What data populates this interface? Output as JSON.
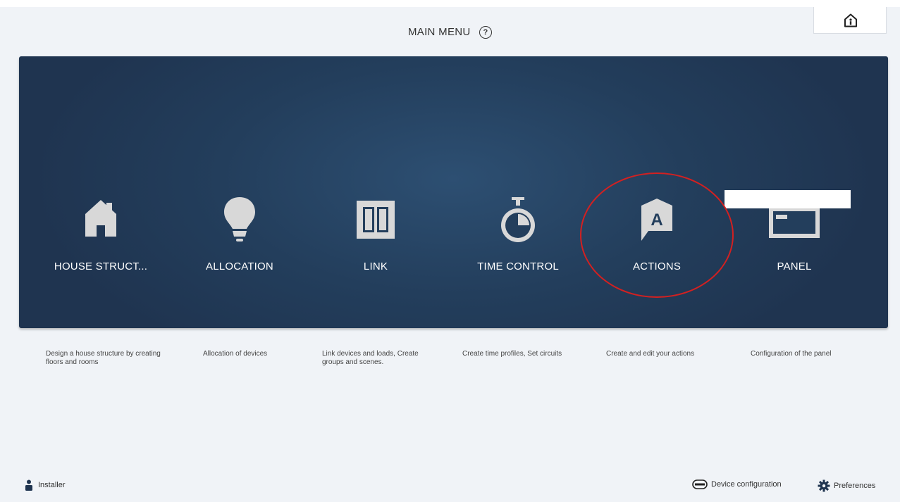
{
  "header": {
    "title": "MAIN MENU",
    "help_glyph": "?",
    "home_icon": "home-info-icon"
  },
  "menu": {
    "tiles": [
      {
        "label": "HOUSE STRUCT...",
        "icon": "house-icon",
        "description": "Design a house structure by creating floors and rooms"
      },
      {
        "label": "ALLOCATION",
        "icon": "lightbulb-icon",
        "description": "Allocation of devices"
      },
      {
        "label": "LINK",
        "icon": "link-switch-icon",
        "description": "Link devices and loads, Create groups and scenes."
      },
      {
        "label": "TIME CONTROL",
        "icon": "stopwatch-icon",
        "description": "Create time profiles, Set circuits"
      },
      {
        "label": "ACTIONS",
        "icon": "actions-icon",
        "description": "Create and edit your actions"
      },
      {
        "label": "PANEL",
        "icon": "panel-icon",
        "description": "Configuration of the panel"
      }
    ],
    "actions_glyph": "A"
  },
  "footer": {
    "user_label": "Installer",
    "device_config_label": "Device configuration",
    "preferences_label": "Preferences"
  },
  "colors": {
    "panel_bg": "#233e5c",
    "tile_icon": "#d8d8d8",
    "highlight": "#d42020"
  }
}
